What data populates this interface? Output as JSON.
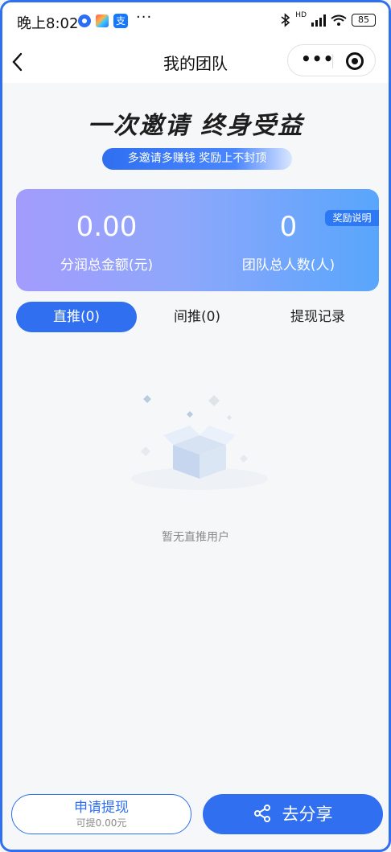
{
  "status_bar": {
    "time": "晚上8:02",
    "dots": "···",
    "battery": "85",
    "network": "HD"
  },
  "nav": {
    "title": "我的团队",
    "back_icon": "chevron-left-icon",
    "more_icon": "more-dots-icon",
    "close_icon": "target-icon"
  },
  "hero": {
    "headline": "一次邀请  终身受益",
    "slogan": "多邀请多赚钱 奖励上不封顶"
  },
  "stats": {
    "badge": "奖励说明",
    "total_amount": "0.00",
    "total_amount_label": "分润总金额(元)",
    "team_count": "0",
    "team_count_label": "团队总人数(人)"
  },
  "tabs": [
    {
      "label": "直推(0)",
      "active": true
    },
    {
      "label": "间推(0)",
      "active": false
    },
    {
      "label": "提现记录",
      "active": false
    }
  ],
  "empty": {
    "icon": "empty-box-icon",
    "text": "暂无直推用户"
  },
  "footer": {
    "withdraw_label": "申请提现",
    "withdraw_sub": "可提0.00元",
    "share_label": "去分享",
    "share_icon": "share-icon"
  },
  "colors": {
    "primary": "#2f6ff0",
    "card_gradient_start": "#a39cfc",
    "card_gradient_end": "#58a6fc",
    "background": "#f6f7f9"
  }
}
